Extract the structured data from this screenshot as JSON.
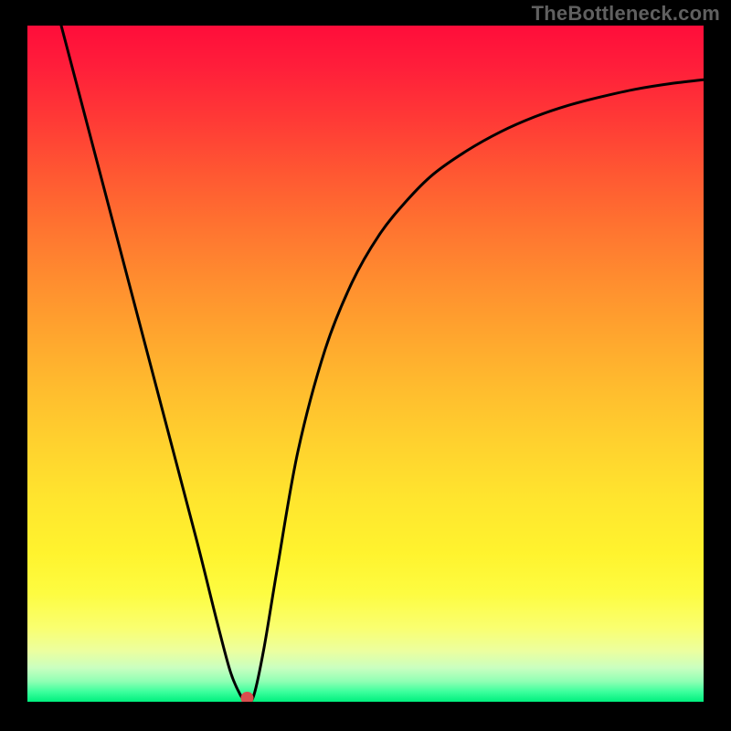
{
  "watermark": "TheBottleneck.com",
  "chart_data": {
    "type": "line",
    "title": "",
    "xlabel": "",
    "ylabel": "",
    "xlim": [
      0,
      1
    ],
    "ylim": [
      0,
      1
    ],
    "grid": false,
    "series": [
      {
        "name": "curve",
        "x": [
          0.05,
          0.1,
          0.15,
          0.2,
          0.25,
          0.28,
          0.3,
          0.315,
          0.325,
          0.335,
          0.35,
          0.37,
          0.4,
          0.44,
          0.48,
          0.52,
          0.56,
          0.6,
          0.65,
          0.7,
          0.75,
          0.8,
          0.85,
          0.9,
          0.95,
          1.0
        ],
        "y": [
          1.0,
          0.81,
          0.62,
          0.43,
          0.24,
          0.12,
          0.045,
          0.01,
          0.0,
          0.01,
          0.08,
          0.2,
          0.37,
          0.52,
          0.62,
          0.69,
          0.74,
          0.78,
          0.815,
          0.843,
          0.865,
          0.882,
          0.895,
          0.906,
          0.914,
          0.92
        ]
      }
    ],
    "marker": {
      "x": 0.325,
      "y": 0.0,
      "color": "#d94e4e",
      "radius_px": 7
    }
  },
  "colors": {
    "curve": "#000000",
    "marker": "#d94e4e",
    "background_frame": "#000000"
  }
}
